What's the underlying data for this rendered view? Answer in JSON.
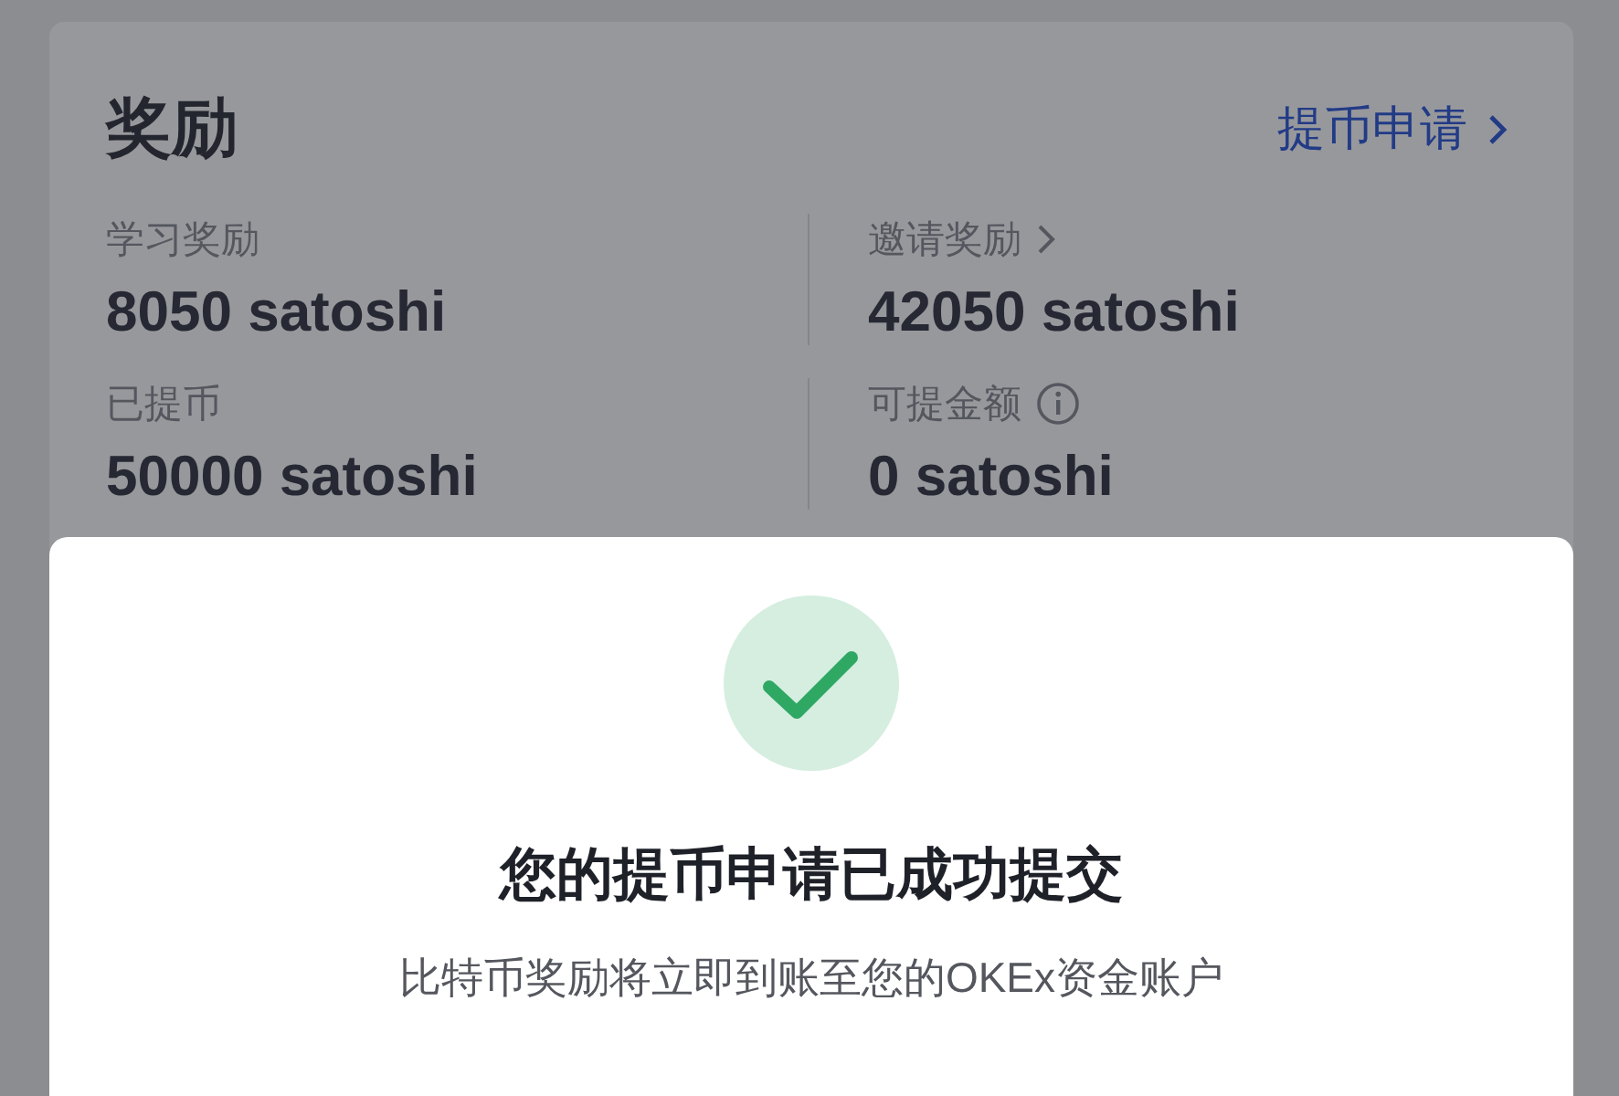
{
  "rewards": {
    "title": "奖励",
    "link": "提币申请",
    "stats": [
      {
        "label": "学习奖励",
        "value": "8050 satoshi",
        "kind": "plain"
      },
      {
        "label": "邀请奖励",
        "value": "42050 satoshi",
        "kind": "link"
      },
      {
        "label": "已提币",
        "value": "50000 satoshi",
        "kind": "plain"
      },
      {
        "label": "可提金额",
        "value": "0 satoshi",
        "kind": "help"
      }
    ]
  },
  "dialog": {
    "title": "您的提币申请已成功提交",
    "message": "比特币奖励将立即到账至您的OKEx资金账户"
  }
}
